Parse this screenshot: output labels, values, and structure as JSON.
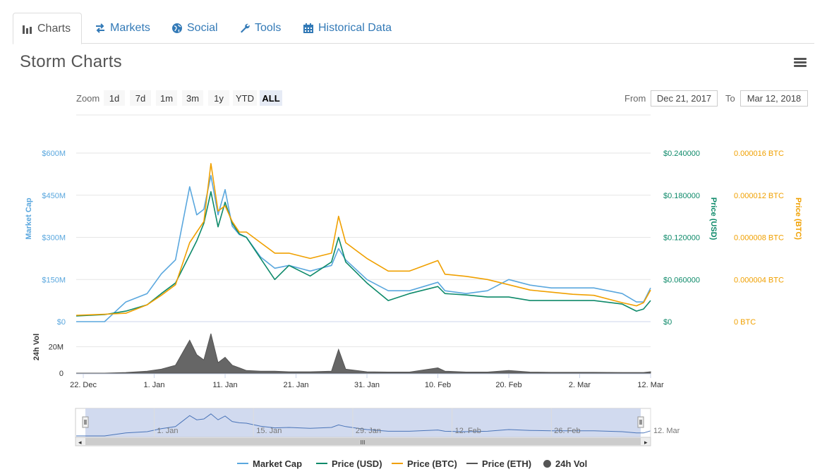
{
  "tabs": [
    {
      "label": "Charts",
      "icon": "bar-chart-icon"
    },
    {
      "label": "Markets",
      "icon": "exchange-icon"
    },
    {
      "label": "Social",
      "icon": "globe-icon"
    },
    {
      "label": "Tools",
      "icon": "wrench-icon"
    },
    {
      "label": "Historical Data",
      "icon": "calendar-icon"
    }
  ],
  "page_title": "Storm Charts",
  "zoom": {
    "label": "Zoom",
    "buttons": [
      "1d",
      "7d",
      "1m",
      "3m",
      "1y",
      "YTD",
      "ALL"
    ],
    "active": "ALL"
  },
  "range": {
    "from_label": "From",
    "from_value": "Dec 21, 2017",
    "to_label": "To",
    "to_value": "Mar 12, 2018"
  },
  "colors": {
    "market_cap": "#5aa7de",
    "price_usd": "#0e8a6a",
    "price_btc": "#f0a000",
    "price_eth": "#555555",
    "volume": "#555555",
    "navigator_fill": "#c9d4ec"
  },
  "chart_data": {
    "type": "line",
    "title": "Storm Charts",
    "x_tick_labels": [
      "22. Dec",
      "1. Jan",
      "11. Jan",
      "21. Jan",
      "31. Jan",
      "10. Feb",
      "20. Feb",
      "2. Mar",
      "12. Mar"
    ],
    "x_range": [
      "2017-12-21",
      "2018-03-12"
    ],
    "axes": {
      "market_cap": {
        "label": "Market Cap",
        "ticks": [
          "$0",
          "$150M",
          "$300M",
          "$450M",
          "$600M"
        ],
        "range": [
          0,
          600000000
        ]
      },
      "price_usd": {
        "label": "Price (USD)",
        "ticks": [
          "$0",
          "$0.060000",
          "$0.120000",
          "$0.180000",
          "$0.240000"
        ],
        "range": [
          0,
          0.24
        ]
      },
      "price_btc": {
        "label": "Price (BTC)",
        "ticks": [
          "0 BTC",
          "0.000004 BTC",
          "0.000008 BTC",
          "0.000012 BTC",
          "0.000016 BTC"
        ],
        "range": [
          0,
          1.6e-05
        ]
      },
      "volume": {
        "label": "24h Vol",
        "ticks": [
          "0",
          "20M"
        ],
        "range": [
          0,
          30000000
        ]
      }
    },
    "x_dates": [
      "2017-12-21",
      "2017-12-25",
      "2017-12-28",
      "2017-12-31",
      "2018-01-02",
      "2018-01-04",
      "2018-01-06",
      "2018-01-07",
      "2018-01-08",
      "2018-01-09",
      "2018-01-10",
      "2018-01-11",
      "2018-01-12",
      "2018-01-13",
      "2018-01-14",
      "2018-01-16",
      "2018-01-18",
      "2018-01-20",
      "2018-01-23",
      "2018-01-26",
      "2018-01-27",
      "2018-01-28",
      "2018-01-31",
      "2018-02-03",
      "2018-02-06",
      "2018-02-10",
      "2018-02-11",
      "2018-02-14",
      "2018-02-17",
      "2018-02-20",
      "2018-02-23",
      "2018-02-26",
      "2018-03-01",
      "2018-03-04",
      "2018-03-08",
      "2018-03-10",
      "2018-03-11",
      "2018-03-12"
    ],
    "series": [
      {
        "name": "Market Cap",
        "axis": "market_cap",
        "values": [
          0,
          0,
          70000000,
          100000000,
          170000000,
          220000000,
          480000000,
          380000000,
          400000000,
          520000000,
          380000000,
          470000000,
          340000000,
          310000000,
          300000000,
          230000000,
          190000000,
          200000000,
          180000000,
          200000000,
          260000000,
          220000000,
          150000000,
          110000000,
          110000000,
          140000000,
          110000000,
          100000000,
          110000000,
          150000000,
          130000000,
          120000000,
          120000000,
          120000000,
          100000000,
          70000000,
          70000000,
          120000000
        ]
      },
      {
        "name": "Price (USD)",
        "axis": "price_usd",
        "values": [
          0.008,
          0.01,
          0.015,
          0.024,
          0.04,
          0.055,
          0.095,
          0.115,
          0.14,
          0.185,
          0.135,
          0.17,
          0.14,
          0.125,
          0.12,
          0.09,
          0.06,
          0.08,
          0.065,
          0.085,
          0.12,
          0.085,
          0.055,
          0.03,
          0.04,
          0.05,
          0.04,
          0.038,
          0.035,
          0.035,
          0.03,
          0.03,
          0.03,
          0.03,
          0.025,
          0.015,
          0.018,
          0.03
        ]
      },
      {
        "name": "Price (BTC)",
        "axis": "price_btc",
        "values": [
          6e-07,
          7e-07,
          8e-07,
          1.6e-06,
          2.5e-06,
          3.5e-06,
          7.5e-06,
          8.5e-06,
          9.5e-06,
          1.5e-05,
          1.05e-05,
          1.1e-05,
          9.5e-06,
          8.5e-06,
          8.5e-06,
          7.5e-06,
          6.5e-06,
          6.5e-06,
          6e-06,
          6.5e-06,
          1e-05,
          7.5e-06,
          6e-06,
          4.8e-06,
          4.8e-06,
          5.8e-06,
          4.5e-06,
          4.3e-06,
          4e-06,
          3.5e-06,
          3e-06,
          2.8e-06,
          2.6e-06,
          2.5e-06,
          1.8e-06,
          1.5e-06,
          1.8e-06,
          3e-06
        ]
      },
      {
        "name": "Price (ETH)",
        "axis": "price_btc",
        "values": []
      },
      {
        "name": "24h Vol",
        "axis": "volume",
        "type": "area",
        "values": [
          0,
          0,
          500000,
          1500000,
          3000000,
          6000000,
          25000000,
          14000000,
          10000000,
          30000000,
          8000000,
          12000000,
          6000000,
          4000000,
          2000000,
          1500000,
          1500000,
          1000000,
          1000000,
          1500000,
          18000000,
          3000000,
          1000000,
          800000,
          800000,
          4000000,
          1500000,
          800000,
          800000,
          2000000,
          800000,
          600000,
          600000,
          600000,
          500000,
          500000,
          500000,
          1000000
        ]
      }
    ],
    "navigator_labels": [
      "1. Jan",
      "15. Jan",
      "29. Jan",
      "12. Feb",
      "26. Feb",
      "12. Mar"
    ],
    "legend_placement": "bottom-center",
    "grid": true
  },
  "legend": [
    {
      "label": "Market Cap",
      "symbol": "line"
    },
    {
      "label": "Price (USD)",
      "symbol": "line"
    },
    {
      "label": "Price (BTC)",
      "symbol": "line"
    },
    {
      "label": "Price (ETH)",
      "symbol": "line"
    },
    {
      "label": "24h Vol",
      "symbol": "dot"
    }
  ],
  "scrollbar": {
    "grip": "III"
  }
}
